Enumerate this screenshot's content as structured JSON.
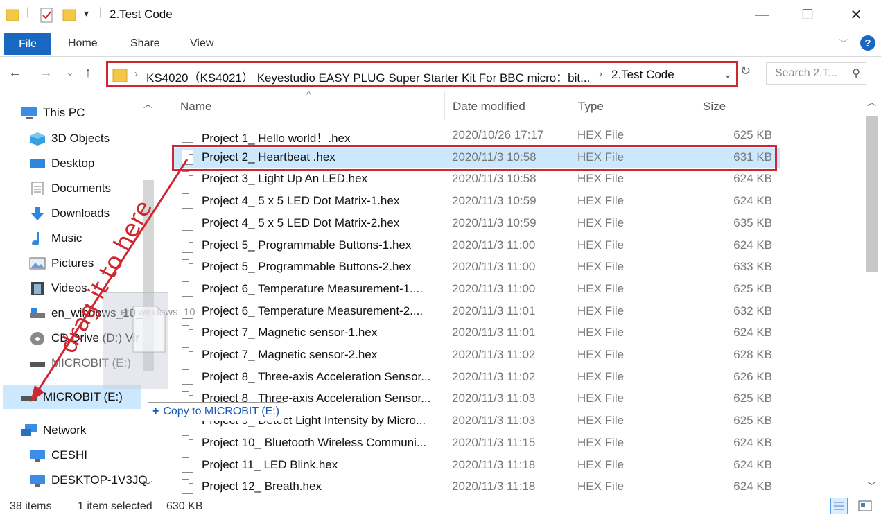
{
  "window": {
    "title": "2.Test Code",
    "minimize_glyph": "—",
    "maximize_glyph": "☐",
    "close_glyph": "✕"
  },
  "ribbon": {
    "tabs": [
      "File",
      "Home",
      "Share",
      "View"
    ],
    "help_glyph": "?",
    "expand_glyph": "﹀"
  },
  "nav": {
    "back_glyph": "←",
    "forward_glyph": "→",
    "recent_glyph": "⌄",
    "up_glyph": "↑",
    "breadcrumb": [
      "KS4020（KS4021） Keyestudio EASY PLUG Super Starter Kit For BBC micro：bit...",
      "2.Test Code"
    ],
    "separator": "›",
    "dropdown_glyph": "⌄",
    "refresh_glyph": "↻",
    "search_placeholder": "Search 2.T...",
    "search_glyph": "⚲"
  },
  "sidebar": {
    "items": [
      {
        "label": "This PC",
        "icon": "pc-icon"
      },
      {
        "label": "3D Objects",
        "icon": "cube-icon"
      },
      {
        "label": "Desktop",
        "icon": "desktop-icon"
      },
      {
        "label": "Documents",
        "icon": "documents-icon"
      },
      {
        "label": "Downloads",
        "icon": "download-icon"
      },
      {
        "label": "Music",
        "icon": "music-icon"
      },
      {
        "label": "Pictures",
        "icon": "pictures-icon"
      },
      {
        "label": "Videos",
        "icon": "videos-icon"
      },
      {
        "label": "en_windows_10_",
        "icon": "drive-icon"
      },
      {
        "label": "CD Drive (D:) Vir",
        "icon": "cd-icon"
      },
      {
        "label": "MICROBIT (E:)",
        "icon": "usb-drive-icon"
      },
      {
        "label": "MICROBIT (E:)",
        "icon": "usb-drive-icon"
      },
      {
        "label": "Network",
        "icon": "network-icon"
      },
      {
        "label": "CESHI",
        "icon": "computer-icon"
      },
      {
        "label": "DESKTOP-1V3JQ",
        "icon": "computer-icon"
      }
    ]
  },
  "columns": {
    "name": "Name",
    "date": "Date modified",
    "type": "Type",
    "size": "Size",
    "sort_glyph": "^"
  },
  "files": [
    {
      "name": "Project 1_ Hello world！.hex",
      "date": "2020/10/26 17:17",
      "type": "HEX File",
      "size": "625 KB"
    },
    {
      "name": "Project 2_ Heartbeat .hex",
      "date": "2020/11/3 10:58",
      "type": "HEX File",
      "size": "631 KB"
    },
    {
      "name": "Project 3_ Light Up An LED.hex",
      "date": "2020/11/3 10:58",
      "type": "HEX File",
      "size": "624 KB"
    },
    {
      "name": "Project 4_ 5 x 5 LED Dot Matrix-1.hex",
      "date": "2020/11/3 10:59",
      "type": "HEX File",
      "size": "624 KB"
    },
    {
      "name": "Project 4_ 5 x 5 LED Dot Matrix-2.hex",
      "date": "2020/11/3 10:59",
      "type": "HEX File",
      "size": "635 KB"
    },
    {
      "name": "Project 5_ Programmable Buttons-1.hex",
      "date": "2020/11/3 11:00",
      "type": "HEX File",
      "size": "624 KB"
    },
    {
      "name": "Project 5_ Programmable Buttons-2.hex",
      "date": "2020/11/3 11:00",
      "type": "HEX File",
      "size": "633 KB"
    },
    {
      "name": "Project 6_ Temperature Measurement-1....",
      "date": "2020/11/3 11:00",
      "type": "HEX File",
      "size": "625 KB"
    },
    {
      "name": "Project 6_ Temperature Measurement-2....",
      "date": "2020/11/3 11:01",
      "type": "HEX File",
      "size": "632 KB"
    },
    {
      "name": "Project 7_ Magnetic sensor-1.hex",
      "date": "2020/11/3 11:01",
      "type": "HEX File",
      "size": "624 KB"
    },
    {
      "name": "Project 7_ Magnetic sensor-2.hex",
      "date": "2020/11/3 11:02",
      "type": "HEX File",
      "size": "628 KB"
    },
    {
      "name": "Project 8_ Three-axis Acceleration Sensor...",
      "date": "2020/11/3 11:02",
      "type": "HEX File",
      "size": "626 KB"
    },
    {
      "name": "Project 8_ Three-axis Acceleration Sensor...",
      "date": "2020/11/3 11:03",
      "type": "HEX File",
      "size": "625 KB"
    },
    {
      "name": "Project 9_ Detect Light Intensity by Micro...",
      "date": "2020/11/3 11:03",
      "type": "HEX File",
      "size": "625 KB"
    },
    {
      "name": "Project 10_ Bluetooth Wireless Communi...",
      "date": "2020/11/3 11:15",
      "type": "HEX File",
      "size": "624 KB"
    },
    {
      "name": "Project 11_ LED Blink.hex",
      "date": "2020/11/3 11:18",
      "type": "HEX File",
      "size": "624 KB"
    },
    {
      "name": "Project 12_ Breath.hex",
      "date": "2020/11/3 11:18",
      "type": "HEX File",
      "size": "624 KB"
    }
  ],
  "selected_index": 1,
  "status": {
    "items": "38 items",
    "selected": "1 item selected",
    "size": "630 KB"
  },
  "drag": {
    "ghost_label": "en_windows_10_",
    "tooltip_plus": "+",
    "tooltip_text": "Copy to MICROBIT (E:)",
    "annotation": "drag it to here"
  },
  "colors": {
    "accent": "#1a67c1",
    "annotation_red": "#d0262f",
    "selection": "#cce8ff"
  }
}
